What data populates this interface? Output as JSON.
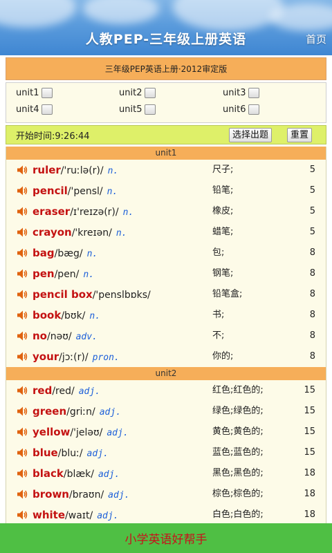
{
  "header": {
    "title": "人教PEP-三年级上册英语",
    "home_label": "首页"
  },
  "edition": "三年级PEP英语上册·2012审定版",
  "units": [
    "unit1",
    "unit2",
    "unit3",
    "unit4",
    "unit5",
    "unit6"
  ],
  "controls": {
    "start_time_label": "开始时间:",
    "start_time": "9:26:44",
    "select_label": "选择出题",
    "reset_label": "重置"
  },
  "icons": {
    "speaker": "speaker-icon",
    "checkbox": "checkbox-icon"
  },
  "colors": {
    "word": "#c41212",
    "pos": "#1c5fd9",
    "unit_header": "#f6ae59",
    "control_bar": "#def069",
    "footer_bg": "#4fbf44",
    "footer_text": "#c8121b"
  },
  "sections": [
    {
      "title": "unit1",
      "words": [
        {
          "en": "ruler",
          "phon": "/'ruːlə(r)/",
          "pos": "n.",
          "cn": "尺子;",
          "num": "5"
        },
        {
          "en": "pencil",
          "phon": "/'pensl/",
          "pos": "n.",
          "cn": "铅笔;",
          "num": "5"
        },
        {
          "en": "eraser",
          "phon": "/ɪ'reɪzə(r)/",
          "pos": "n.",
          "cn": "橡皮;",
          "num": "5"
        },
        {
          "en": "crayon",
          "phon": "/'kreɪən/",
          "pos": "n.",
          "cn": "蜡笔;",
          "num": "5"
        },
        {
          "en": "bag",
          "phon": "/bæg/",
          "pos": "n.",
          "cn": "包;",
          "num": "8"
        },
        {
          "en": "pen",
          "phon": "/pen/",
          "pos": "n.",
          "cn": "钢笔;",
          "num": "8"
        },
        {
          "en": "pencil box",
          "phon": "/'penslbɒks/",
          "pos": "",
          "cn": "铅笔盒;",
          "num": "8"
        },
        {
          "en": "book",
          "phon": "/bʊk/",
          "pos": "n.",
          "cn": "书;",
          "num": "8"
        },
        {
          "en": "no",
          "phon": "/nəʊ/",
          "pos": "adv.",
          "cn": "不;",
          "num": "8"
        },
        {
          "en": "your",
          "phon": "/jɔː(r)/",
          "pos": "pron.",
          "cn": "你的;",
          "num": "8"
        }
      ]
    },
    {
      "title": "unit2",
      "words": [
        {
          "en": "red",
          "phon": "/red/",
          "pos": "adj.",
          "cn": "红色;红色的;",
          "num": "15"
        },
        {
          "en": "green",
          "phon": "/griːn/",
          "pos": "adj.",
          "cn": "绿色;绿色的;",
          "num": "15"
        },
        {
          "en": "yellow",
          "phon": "/'jeləʊ/",
          "pos": "adj.",
          "cn": "黄色;黄色的;",
          "num": "15"
        },
        {
          "en": "blue",
          "phon": "/bluː/",
          "pos": "adj.",
          "cn": "蓝色;蓝色的;",
          "num": "15"
        },
        {
          "en": "black",
          "phon": "/blæk/",
          "pos": "adj.",
          "cn": "黑色;黑色的;",
          "num": "18"
        },
        {
          "en": "brown",
          "phon": "/braʊn/",
          "pos": "adj.",
          "cn": "棕色;棕色的;",
          "num": "18"
        },
        {
          "en": "white",
          "phon": "/waɪt/",
          "pos": "adj.",
          "cn": "白色;白色的;",
          "num": "18"
        }
      ]
    }
  ],
  "footer": {
    "text": "小学英语好帮手"
  }
}
